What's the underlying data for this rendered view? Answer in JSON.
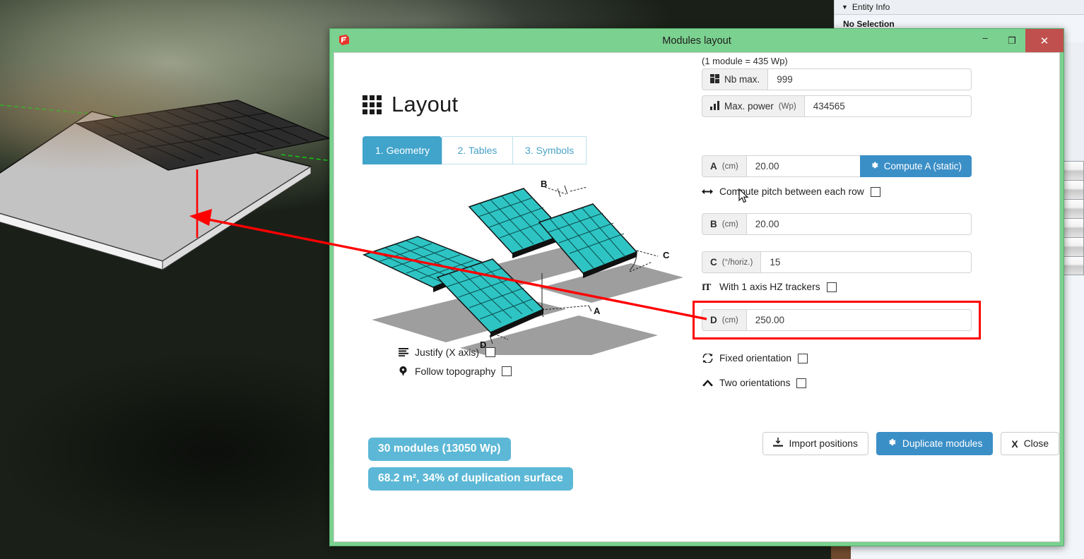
{
  "window": {
    "title": "Modules layout",
    "app_icon": "sketchup-logo-icon",
    "minimize": "–",
    "maximize": "❐",
    "close": "✕"
  },
  "header": {
    "title": "Layout",
    "icon": "grid-icon"
  },
  "tabs": [
    {
      "label": "1.  Geometry",
      "active": true
    },
    {
      "label": "2.  Tables",
      "active": false
    },
    {
      "label": "3.  Symbols",
      "active": false
    }
  ],
  "diagram": {
    "labels": [
      "A",
      "B",
      "C",
      "D"
    ],
    "panel_color": "#2ec4c4",
    "shadow_color": "#9a9a9a"
  },
  "left_options": [
    {
      "icon": "align-justify-icon",
      "label": "Justify (X axis)",
      "checked": false
    },
    {
      "icon": "map-pin-icon",
      "label": "Follow topography",
      "checked": false
    }
  ],
  "badges": [
    {
      "text": "30 modules (13050 Wp)"
    },
    {
      "text": "68.2 m², 34% of duplication surface"
    }
  ],
  "right_panel": {
    "module_note": "(1 module = 435 Wp)",
    "fields": {
      "nb_max": {
        "icon": "blocks-icon",
        "label": "Nb max.",
        "value": "999"
      },
      "max_power": {
        "icon": "bar-chart-icon",
        "label": "Max. power",
        "unit": "(Wp)",
        "value": "434565"
      },
      "a": {
        "label": "A",
        "unit": "(cm)",
        "value": "20.00",
        "button": "Compute A (static)",
        "button_icon": "gear-icon"
      },
      "b": {
        "label": "B",
        "unit": "(cm)",
        "value": "20.00"
      },
      "c": {
        "label": "C",
        "unit": "(°/horiz.)",
        "value": "15"
      },
      "d": {
        "label": "D",
        "unit": "(cm)",
        "value": "250.00",
        "highlighted": true,
        "highlight_color": "#ff0000"
      }
    },
    "options": [
      {
        "icon": "arrows-horizontal-icon",
        "label": "Compute pitch between each row",
        "checked": false
      },
      {
        "icon": "tracker-it-icon",
        "label": "With 1 axis HZ trackers",
        "checked": false
      },
      {
        "icon": "refresh-icon",
        "label": "Fixed orientation",
        "checked": false
      },
      {
        "icon": "chevron-up-icon",
        "label": "Two orientations",
        "checked": false
      }
    ],
    "buttons": [
      {
        "label": "Import positions",
        "icon": "import-icon",
        "style": "white"
      },
      {
        "label": "Duplicate modules",
        "icon": "gear-icon",
        "style": "blue"
      },
      {
        "label": "Close",
        "icon": "x-icon",
        "style": "white"
      }
    ]
  },
  "entity_panel": {
    "header": "Entity Info",
    "caret": "▼",
    "body": "No Selection"
  },
  "colors": {
    "dialog_frame": "#7bd18f",
    "accent_blue": "#3b8fc7",
    "tab_active": "#41a4cb",
    "badge": "#5cb8d6",
    "close_button": "#c0504d",
    "annotation": "#ff0000"
  }
}
